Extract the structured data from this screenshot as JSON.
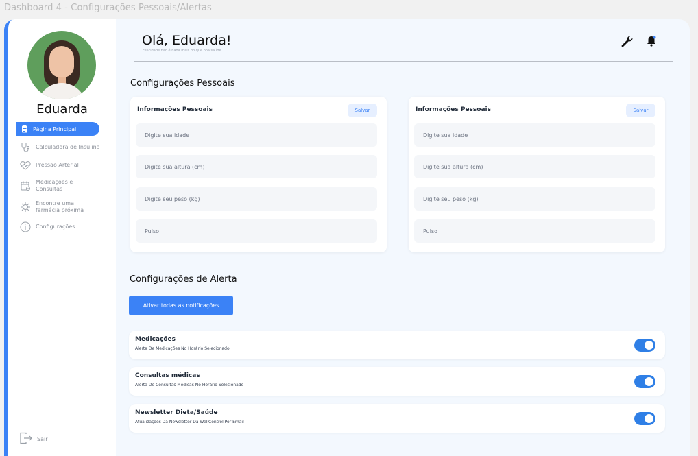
{
  "frame_title": "Dashboard 4 - Configurações Pessoais/Alertas",
  "user": {
    "name": "Eduarda"
  },
  "nav": {
    "active": "Página Principal",
    "items": [
      {
        "label": "Calculadora de Insulina",
        "icon": "stethoscope-icon"
      },
      {
        "label": "Pressão Arterial",
        "icon": "heartbeat-icon"
      },
      {
        "label": "Medicações e Consultas",
        "icon": "calendar-icon"
      },
      {
        "label": "Encontre uma farmácia próxima",
        "icon": "virus-icon"
      },
      {
        "label": "Configurações",
        "icon": "info-icon"
      }
    ],
    "logout": "Sair"
  },
  "header": {
    "greeting": "Olá, Eduarda!",
    "subtitle": "Felicidade não é nada mais do que boa saúde"
  },
  "personal": {
    "section_title": "Configurações Pessoais",
    "panels": [
      {
        "title": "Informações Pessoais",
        "save_label": "Salvar",
        "fields": [
          "Digite sua idade",
          "Digite sua altura (cm)",
          "Digite seu peso (kg)",
          "Pulso"
        ]
      },
      {
        "title": "Informações Pessoais",
        "save_label": "Salvar",
        "fields": [
          "Digite sua idade",
          "Digite sua altura (cm)",
          "Digite seu peso (kg)",
          "Pulso"
        ]
      }
    ]
  },
  "alerts": {
    "section_title": "Configurações de Alerta",
    "activate_all": "Ativar todas as notificações",
    "items": [
      {
        "title": "Medicações",
        "description": "Alerta De Medicações No Horário Selecionado",
        "enabled": true
      },
      {
        "title": "Consultas médicas",
        "description": "Alerta De Consultas Médicas No Horário Selecionado",
        "enabled": true
      },
      {
        "title": "Newsletter Dieta/Saúde",
        "description": "Atualizações Da Newsletter Da WellControl Por Email",
        "enabled": true
      }
    ]
  },
  "colors": {
    "accent": "#3b82f6",
    "toggle_on": "#2f7fe6",
    "background": "#f3f8fe"
  }
}
